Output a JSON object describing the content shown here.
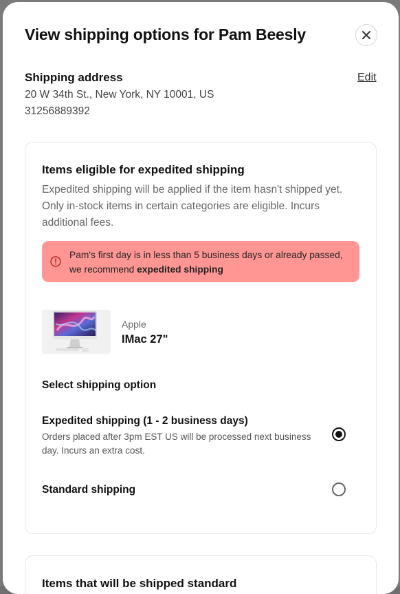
{
  "modal": {
    "title": "View shipping options for Pam Beesly"
  },
  "address": {
    "heading": "Shipping address",
    "edit_label": "Edit",
    "line1": "20 W 34th St., New York, NY 10001, US",
    "phone": "31256889392"
  },
  "expedited_card": {
    "heading": "Items eligible for expedited shipping",
    "description": "Expedited shipping will be applied if the item hasn't shipped yet. Only in-stock items in certain categories are eligible. Incurs additional fees.",
    "alert": {
      "text_before": "Pam's first day is in less than 5 business days or already passed, we recommend ",
      "text_bold": "expedited shipping",
      "bg_color": "#ff9693"
    },
    "product": {
      "brand": "Apple",
      "name": "IMac 27\""
    },
    "select_heading": "Select shipping option",
    "options": [
      {
        "title": "Expedited shipping (1 - 2 business days)",
        "description": "Orders placed after 3pm EST US will be processed next business day. Incurs an extra cost.",
        "selected": true
      },
      {
        "title": "Standard shipping",
        "description": "",
        "selected": false
      }
    ]
  },
  "standard_card": {
    "heading": "Items that will be shipped standard"
  },
  "icons": {
    "close": "close-icon",
    "alert": "alert-circle-icon",
    "product": "imac-image"
  }
}
